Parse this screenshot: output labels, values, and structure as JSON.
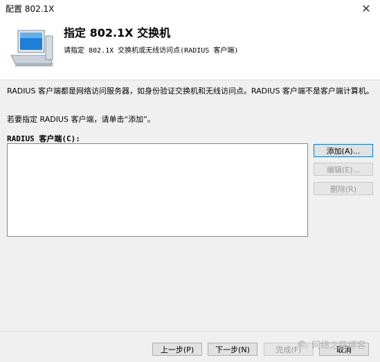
{
  "window": {
    "title": "配置 802.1X",
    "close_glyph": "✕"
  },
  "header": {
    "title": "指定 802.1X 交换机",
    "subtitle": "请指定 802.1X 交换机或无线访问点(RADIUS 客户端)",
    "icon": "computer-monitor-icon"
  },
  "body": {
    "description": "RADIUS 客户端都是网络访问服务器，如身份验证交换机和无线访问点。RADIUS 客户端不是客户端计算机。",
    "hint": "若要指定 RADIUS 客户端，请单击“添加”。",
    "list_label": "RADIUS 客户端(C):",
    "clients": []
  },
  "buttons": {
    "add": "添加(A)...",
    "edit": "编辑(E)...",
    "remove": "删除(R)"
  },
  "footer": {
    "back": "上一步(P)",
    "next": "下一步(N)",
    "finish": "完成(F)",
    "cancel": "取消"
  },
  "watermark": "网络之路博客",
  "colors": {
    "accent": "#0078d7",
    "header_bg": "#ffffff",
    "dialog_bg": "#f0f0f0"
  }
}
